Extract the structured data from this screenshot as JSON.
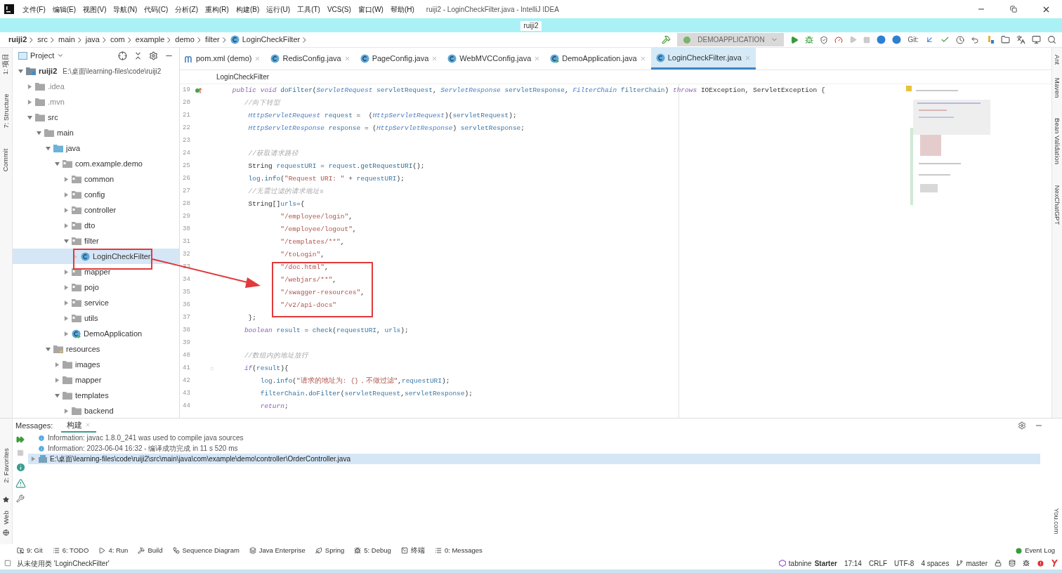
{
  "window": {
    "title": "ruiji2 - LoginCheckFilter.java - IntelliJ IDEA"
  },
  "menu": [
    "文件(F)",
    "编辑(E)",
    "视图(V)",
    "导航(N)",
    "代码(C)",
    "分析(Z)",
    "重构(R)",
    "构建(B)",
    "运行(U)",
    "工具(T)",
    "VCS(S)",
    "窗口(W)",
    "帮助(H)"
  ],
  "project_tab": "ruiji2",
  "breadcrumbs": [
    {
      "label": "ruiji2",
      "kind": "project"
    },
    {
      "label": "src",
      "kind": "dir"
    },
    {
      "label": "main",
      "kind": "dir"
    },
    {
      "label": "java",
      "kind": "dir"
    },
    {
      "label": "com",
      "kind": "dir"
    },
    {
      "label": "example",
      "kind": "dir"
    },
    {
      "label": "demo",
      "kind": "dir"
    },
    {
      "label": "filter",
      "kind": "dir"
    },
    {
      "label": "LoginCheckFilter",
      "kind": "class"
    }
  ],
  "run_configuration": "DEMOAPPLICATION",
  "git_label": "Git:",
  "left_stripe_top": [
    "1: 项目",
    "7: Structure",
    "Commit"
  ],
  "left_stripe_bottom": [
    "2: Favorites",
    "Web"
  ],
  "right_stripe_top": [
    "Ant",
    "Maven",
    "Bean Validation",
    "NexChatGPT"
  ],
  "right_stripe_bottom": [
    "You.com"
  ],
  "project_panel": {
    "title": "Project",
    "tree": [
      {
        "label": "ruiji2",
        "path": "E:\\桌面\\learning-files\\code\\ruiji2",
        "kind": "module",
        "expanded": true,
        "selected": false,
        "children": [
          {
            "label": ".idea",
            "kind": "folder",
            "expanded": false,
            "selected": false
          },
          {
            "label": ".mvn",
            "kind": "folder",
            "expanded": false,
            "selected": false
          },
          {
            "label": "src",
            "kind": "folder",
            "expanded": true,
            "selected": false,
            "children": [
              {
                "label": "main",
                "kind": "folder",
                "expanded": true,
                "selected": false,
                "children": [
                  {
                    "label": "java",
                    "kind": "source",
                    "expanded": true,
                    "selected": false,
                    "children": [
                      {
                        "label": "com.example.demo",
                        "kind": "package",
                        "expanded": true,
                        "selected": false,
                        "children": [
                          {
                            "label": "common",
                            "kind": "package",
                            "expanded": false,
                            "selected": false
                          },
                          {
                            "label": "config",
                            "kind": "package",
                            "expanded": false,
                            "selected": false
                          },
                          {
                            "label": "controller",
                            "kind": "package",
                            "expanded": false,
                            "selected": false
                          },
                          {
                            "label": "dto",
                            "kind": "package",
                            "expanded": false,
                            "selected": false
                          },
                          {
                            "label": "filter",
                            "kind": "package",
                            "expanded": true,
                            "selected": false,
                            "children": [
                              {
                                "label": "LoginCheckFilter",
                                "kind": "class",
                                "expanded": false,
                                "selected": true
                              }
                            ]
                          },
                          {
                            "label": "mapper",
                            "kind": "package",
                            "expanded": false,
                            "selected": false
                          },
                          {
                            "label": "pojo",
                            "kind": "package",
                            "expanded": false,
                            "selected": false
                          },
                          {
                            "label": "service",
                            "kind": "package",
                            "expanded": false,
                            "selected": false
                          },
                          {
                            "label": "utils",
                            "kind": "package",
                            "expanded": false,
                            "selected": false
                          },
                          {
                            "label": "DemoApplication",
                            "kind": "app",
                            "expanded": false,
                            "selected": false
                          }
                        ]
                      }
                    ]
                  },
                  {
                    "label": "resources",
                    "kind": "resources",
                    "expanded": true,
                    "selected": false,
                    "children": [
                      {
                        "label": "images",
                        "kind": "folder",
                        "expanded": false,
                        "selected": false
                      },
                      {
                        "label": "mapper",
                        "kind": "folder",
                        "expanded": false,
                        "selected": false
                      },
                      {
                        "label": "templates",
                        "kind": "folder",
                        "expanded": true,
                        "selected": false,
                        "children": [
                          {
                            "label": "backend",
                            "kind": "folder",
                            "expanded": false,
                            "selected": false
                          }
                        ]
                      }
                    ]
                  }
                ]
              }
            ]
          }
        ]
      }
    ]
  },
  "editor": {
    "tabs": [
      {
        "label": "pom.xml (demo)",
        "kind": "maven",
        "selected": false
      },
      {
        "label": "RedisConfig.java",
        "kind": "class",
        "selected": false
      },
      {
        "label": "PageConfig.java",
        "kind": "class",
        "selected": false
      },
      {
        "label": "WebMVCConfig.java",
        "kind": "class",
        "selected": false
      },
      {
        "label": "DemoApplication.java",
        "kind": "app",
        "selected": false
      },
      {
        "label": "LoginCheckFilter.java",
        "kind": "class",
        "selected": true
      }
    ],
    "breadcrumb": "LoginCheckFilter",
    "lines": [
      {
        "number": "19",
        "overridden": true,
        "tokens": [
          {
            "kind": "keyword",
            "text": "    public void "
          },
          {
            "kind": "function",
            "text": "doFilter"
          },
          {
            "kind": "plain",
            "text": "("
          },
          {
            "kind": "type",
            "text": "ServletRequest "
          },
          {
            "kind": "variable",
            "text": "servletRequest"
          },
          {
            "kind": "plain",
            "text": ", "
          },
          {
            "kind": "type",
            "text": "ServletResponse "
          },
          {
            "kind": "variable",
            "text": "servletResponse"
          },
          {
            "kind": "plain",
            "text": ", "
          },
          {
            "kind": "type",
            "text": "FilterChain "
          },
          {
            "kind": "variable",
            "text": "filterChain"
          },
          {
            "kind": "plain",
            "text": ") "
          },
          {
            "kind": "keyword",
            "text": "throws "
          },
          {
            "kind": "plain",
            "text": "IOException, ServletException {"
          }
        ]
      },
      {
        "number": "20",
        "tokens": [
          {
            "kind": "comment",
            "text": "       //向下转型"
          }
        ]
      },
      {
        "number": "21",
        "tokens": [
          {
            "kind": "type",
            "text": "        HttpServletRequest "
          },
          {
            "kind": "variable",
            "text": "request"
          },
          {
            "kind": "plain",
            "text": " =  ("
          },
          {
            "kind": "type",
            "text": "HttpServletRequest"
          },
          {
            "kind": "plain",
            "text": ")("
          },
          {
            "kind": "variable",
            "text": "servletRequest"
          },
          {
            "kind": "plain",
            "text": ");"
          }
        ]
      },
      {
        "number": "22",
        "tokens": [
          {
            "kind": "type",
            "text": "        HttpServletResponse "
          },
          {
            "kind": "variable",
            "text": "response"
          },
          {
            "kind": "plain",
            "text": " = ("
          },
          {
            "kind": "type",
            "text": "HttpServletResponse"
          },
          {
            "kind": "plain",
            "text": ") "
          },
          {
            "kind": "variable",
            "text": "servletResponse"
          },
          {
            "kind": "plain",
            "text": ";"
          }
        ]
      },
      {
        "number": "23"
      },
      {
        "number": "24",
        "tokens": [
          {
            "kind": "comment",
            "text": "        //获取请求路径"
          }
        ]
      },
      {
        "number": "25",
        "tokens": [
          {
            "kind": "plain",
            "text": "        String "
          },
          {
            "kind": "variable",
            "text": "requestURI"
          },
          {
            "kind": "plain",
            "text": " = "
          },
          {
            "kind": "variable",
            "text": "request"
          },
          {
            "kind": "plain",
            "text": "."
          },
          {
            "kind": "function",
            "text": "getRequestURI"
          },
          {
            "kind": "plain",
            "text": "();"
          }
        ]
      },
      {
        "number": "26",
        "tokens": [
          {
            "kind": "variable",
            "text": "        log"
          },
          {
            "kind": "plain",
            "text": "."
          },
          {
            "kind": "function",
            "text": "info"
          },
          {
            "kind": "plain",
            "text": "("
          },
          {
            "kind": "string",
            "text": "\"Request URI: \""
          },
          {
            "kind": "plain",
            "text": " + "
          },
          {
            "kind": "variable",
            "text": "requestURI"
          },
          {
            "kind": "plain",
            "text": ");"
          }
        ]
      },
      {
        "number": "27",
        "tokens": [
          {
            "kind": "comment",
            "text": "        //无需过滤的请求地址s"
          }
        ]
      },
      {
        "number": "28",
        "tokens": [
          {
            "kind": "plain",
            "text": "        String[]"
          },
          {
            "kind": "variable",
            "text": "urls"
          },
          {
            "kind": "plain",
            "text": "={"
          }
        ]
      },
      {
        "number": "29",
        "tokens": [
          {
            "kind": "string",
            "text": "                \"/employee/login\""
          },
          {
            "kind": "plain",
            "text": ","
          }
        ]
      },
      {
        "number": "30",
        "tokens": [
          {
            "kind": "string",
            "text": "                \"/employee/logout\""
          },
          {
            "kind": "plain",
            "text": ","
          }
        ]
      },
      {
        "number": "31",
        "tokens": [
          {
            "kind": "string",
            "text": "                \"/templates/**\""
          },
          {
            "kind": "plain",
            "text": ","
          }
        ]
      },
      {
        "number": "32",
        "tokens": [
          {
            "kind": "string",
            "text": "                \"/toLogin\""
          },
          {
            "kind": "plain",
            "text": ","
          }
        ]
      },
      {
        "number": "33",
        "tokens": [
          {
            "kind": "string",
            "text": "                \"/doc.html\""
          },
          {
            "kind": "plain",
            "text": ","
          }
        ]
      },
      {
        "number": "34",
        "tokens": [
          {
            "kind": "string",
            "text": "                \"/webjars/**\""
          },
          {
            "kind": "plain",
            "text": ","
          }
        ]
      },
      {
        "number": "35",
        "tokens": [
          {
            "kind": "string",
            "text": "                \"/swagger-resources\""
          },
          {
            "kind": "plain",
            "text": ","
          }
        ]
      },
      {
        "number": "36",
        "tokens": [
          {
            "kind": "string",
            "text": "                \"/v2/api-docs\""
          }
        ]
      },
      {
        "number": "37",
        "tokens": [
          {
            "kind": "plain",
            "text": "        };"
          }
        ]
      },
      {
        "number": "38",
        "tokens": [
          {
            "kind": "keyword",
            "text": "       boolean "
          },
          {
            "kind": "variable",
            "text": "result"
          },
          {
            "kind": "plain",
            "text": " = "
          },
          {
            "kind": "function",
            "text": "check"
          },
          {
            "kind": "plain",
            "text": "("
          },
          {
            "kind": "variable",
            "text": "requestURI"
          },
          {
            "kind": "plain",
            "text": ", "
          },
          {
            "kind": "variable",
            "text": "urls"
          },
          {
            "kind": "plain",
            "text": ");"
          }
        ]
      },
      {
        "number": "39"
      },
      {
        "number": "40",
        "tokens": [
          {
            "kind": "comment",
            "text": "       //数组内的地址放行"
          }
        ]
      },
      {
        "number": "41",
        "fold": true,
        "tokens": [
          {
            "kind": "keyword",
            "text": "       if"
          },
          {
            "kind": "plain",
            "text": "("
          },
          {
            "kind": "variable",
            "text": "result"
          },
          {
            "kind": "plain",
            "text": "){"
          }
        ]
      },
      {
        "number": "42",
        "tokens": [
          {
            "kind": "variable",
            "text": "           log"
          },
          {
            "kind": "plain",
            "text": "."
          },
          {
            "kind": "function",
            "text": "info"
          },
          {
            "kind": "plain",
            "text": "("
          },
          {
            "kind": "string",
            "text": "\"请求的地址为: {}，不做过滤\""
          },
          {
            "kind": "plain",
            "text": ","
          },
          {
            "kind": "variable",
            "text": "requestURI"
          },
          {
            "kind": "plain",
            "text": ");"
          }
        ]
      },
      {
        "number": "43",
        "tokens": [
          {
            "kind": "variable",
            "text": "           filterChain"
          },
          {
            "kind": "plain",
            "text": "."
          },
          {
            "kind": "function",
            "text": "doFilter"
          },
          {
            "kind": "plain",
            "text": "("
          },
          {
            "kind": "variable",
            "text": "servletRequest"
          },
          {
            "kind": "plain",
            "text": ","
          },
          {
            "kind": "variable",
            "text": "servletResponse"
          },
          {
            "kind": "plain",
            "text": ");"
          }
        ]
      },
      {
        "number": "44",
        "tokens": [
          {
            "kind": "keyword",
            "text": "           return"
          },
          {
            "kind": "plain",
            "text": ";"
          }
        ]
      }
    ]
  },
  "messages": {
    "label": "Messages:",
    "tabs": [
      {
        "label": "构建",
        "selected": true
      }
    ],
    "rows": [
      {
        "kind": "info",
        "text": "Information: javac 1.8.0_241 was used to compile java sources",
        "selected": false
      },
      {
        "kind": "info",
        "text": "Information: 2023-06-04 16:32 - 编译成功完成 in 11 s 520 ms",
        "selected": false
      },
      {
        "kind": "file",
        "text": "E:\\桌面\\learning-files\\code\\ruiji2\\src\\main\\java\\com\\example\\demo\\controller\\OrderController.java",
        "selected": true
      }
    ]
  },
  "tool_windows": [
    {
      "label": "9: Git",
      "kind": "git"
    },
    {
      "label": "6: TODO",
      "kind": "todo"
    },
    {
      "label": "4: Run",
      "kind": "run"
    },
    {
      "label": "Build",
      "kind": "build"
    },
    {
      "label": "Sequence Diagram",
      "kind": "sequence"
    },
    {
      "label": "Java Enterprise",
      "kind": "enterprise"
    },
    {
      "label": "Spring",
      "kind": "spring"
    },
    {
      "label": "5: Debug",
      "kind": "debug"
    },
    {
      "label": "终端",
      "kind": "terminal"
    },
    {
      "label": "0: Messages",
      "kind": "messages"
    }
  ],
  "event_log": "Event Log",
  "status_bar": {
    "message": "从未使用类 'LoginCheckFilter'",
    "tabnine": "tabnine",
    "plan": "Starter",
    "items": [
      "17:14",
      "CRLF",
      "UTF-8",
      "4 spaces"
    ],
    "branch": "master"
  }
}
